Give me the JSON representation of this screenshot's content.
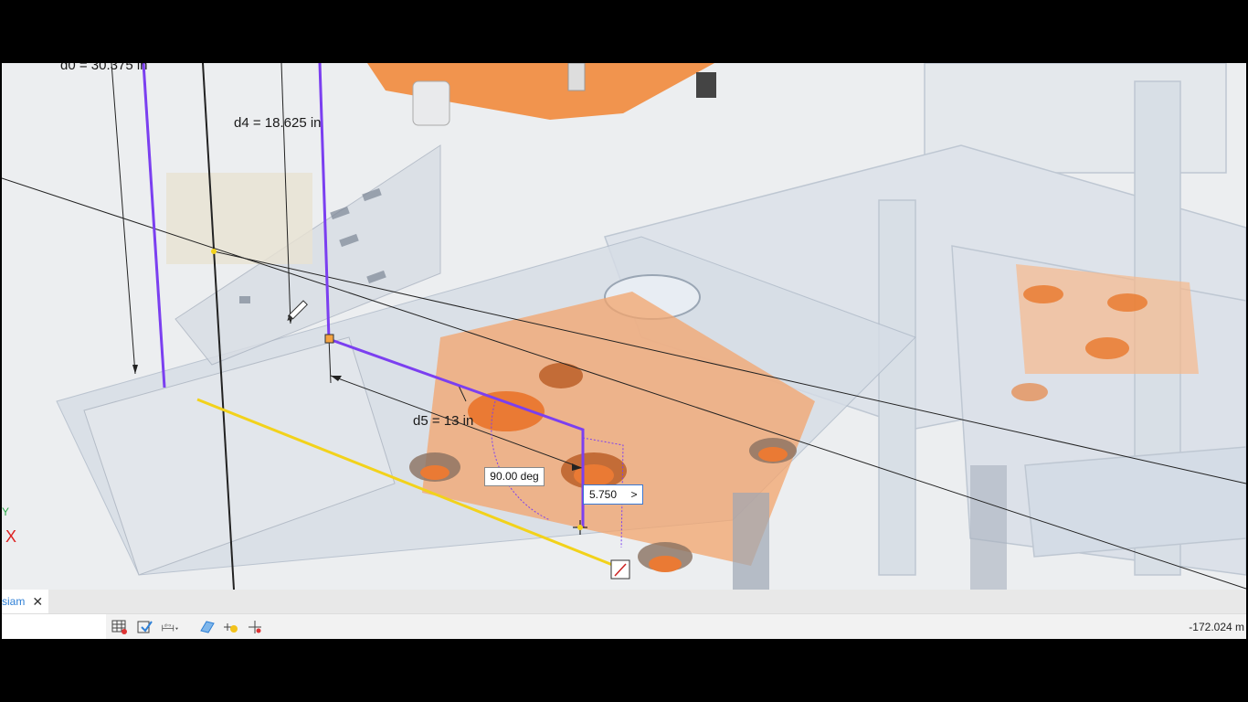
{
  "viewport": {
    "dimensions": {
      "d0": "d0 = 30.375 in",
      "d4": "d4 = 18.625 in",
      "d5": "d5 = 13 in"
    },
    "angle_input": "90.00 deg",
    "length_input": "5.750",
    "length_input_button": ">",
    "triad": {
      "y_label": "Y",
      "x_label": "X"
    }
  },
  "tabs": [
    {
      "label": "siam",
      "close": "✕"
    }
  ],
  "status": {
    "coordinate": "-172.024 m",
    "tools": [
      "grid-icon",
      "constraint-icon",
      "dimension-icon",
      "plane-icon",
      "light-icon",
      "snap-icon"
    ]
  },
  "colors": {
    "sketch_line": "#7b3ff0",
    "yellow_line": "#f2d21b",
    "orange_part": "#f28a3c",
    "tab_accent": "#2f80d6"
  }
}
